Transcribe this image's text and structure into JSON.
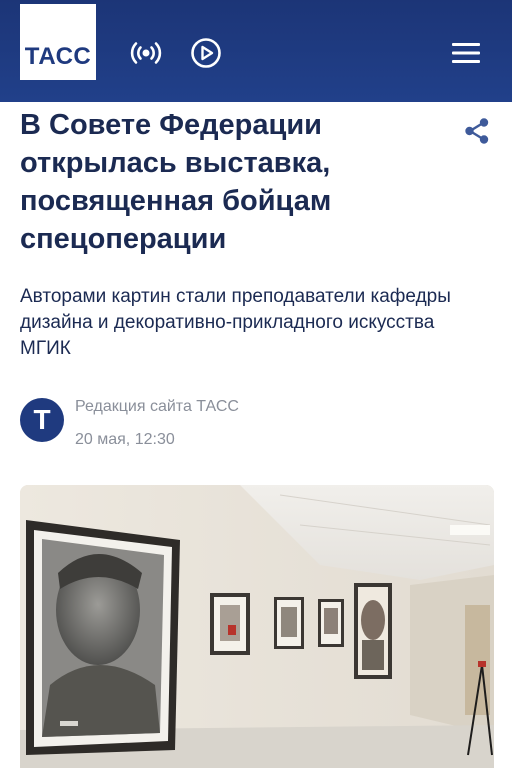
{
  "header": {
    "logo_text": "ТАСС",
    "icons": [
      "radio-icon",
      "play-icon",
      "menu-icon"
    ],
    "background": "#1f3a7f"
  },
  "article": {
    "title": "В Совете Федерации открылась выставка, посвященная бойцам спецоперации",
    "subtitle": "Авторами картин стали преподаватели кафедры дизайна и декоративно-прикладного искусства МГИК",
    "author_initial": "Т",
    "author": "Редакция сайта ТАСС",
    "date": "20 мая, 12:30"
  },
  "colors": {
    "brand": "#1f3a7f",
    "text": "#1b2a52",
    "muted": "#8a8f9a"
  }
}
